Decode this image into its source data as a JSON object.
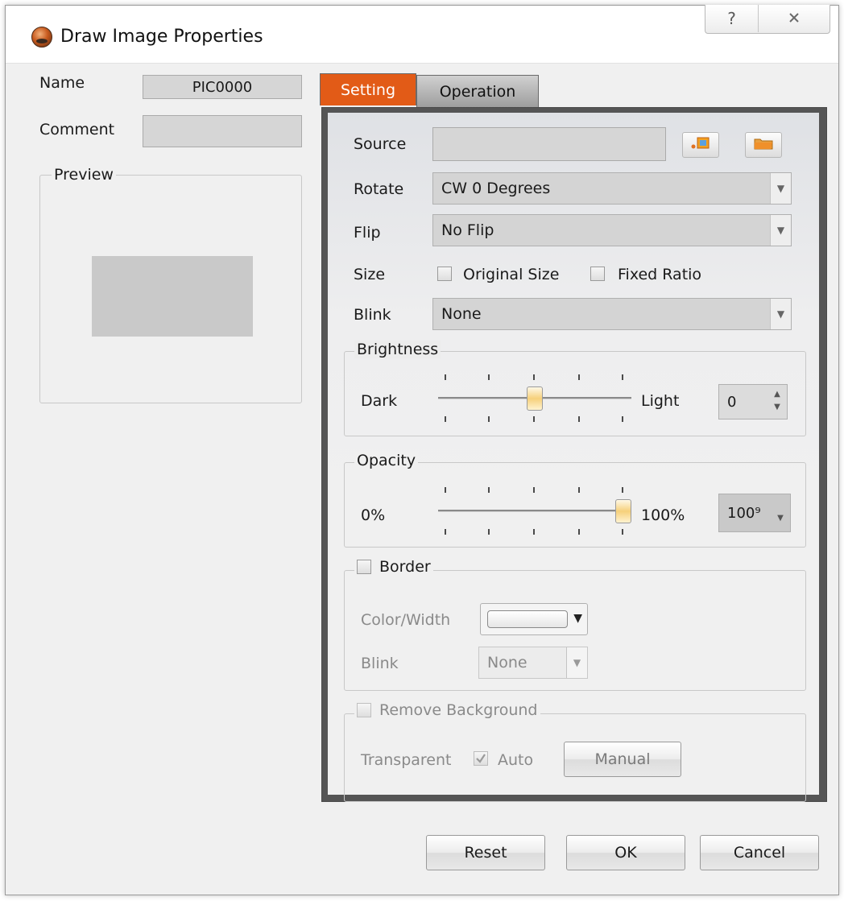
{
  "window": {
    "title": "Draw Image Properties",
    "help_glyph": "?",
    "close_glyph": "✕"
  },
  "left": {
    "name_label": "Name",
    "name_value": "PIC0000",
    "comment_label": "Comment",
    "comment_value": "",
    "preview_label": "Preview"
  },
  "tabs": [
    {
      "label": "Setting",
      "active": true
    },
    {
      "label": "Operation",
      "active": false
    }
  ],
  "setting": {
    "source_label": "Source",
    "source_value": "",
    "rotate_label": "Rotate",
    "rotate_value": "CW 0 Degrees",
    "flip_label": "Flip",
    "flip_value": "No Flip",
    "size_label": "Size",
    "original_size_label": "Original Size",
    "original_size_checked": false,
    "fixed_ratio_label": "Fixed Ratio",
    "fixed_ratio_checked": false,
    "blink_label": "Blink",
    "blink_value": "None",
    "brightness": {
      "group_label": "Brightness",
      "min_label": "Dark",
      "max_label": "Light",
      "value": "0",
      "slider_fraction": 0.5
    },
    "opacity": {
      "group_label": "Opacity",
      "min_label": "0%",
      "max_label": "100%",
      "value": "100%",
      "value_display": "100⁹",
      "slider_fraction": 1.0
    },
    "border": {
      "group_label": "Border",
      "checked": false,
      "color_width_label": "Color/Width",
      "blink_label": "Blink",
      "blink_value": "None"
    },
    "remove_background": {
      "group_label": "Remove Background",
      "checked": false,
      "transparent_label": "Transparent",
      "auto_label": "Auto",
      "auto_checked": true,
      "manual_label": "Manual"
    }
  },
  "buttons": {
    "reset": "Reset",
    "ok": "OK",
    "cancel": "Cancel"
  },
  "colors": {
    "active_tab": "#e25b17",
    "dialog_bg": "#f0f0f0"
  }
}
